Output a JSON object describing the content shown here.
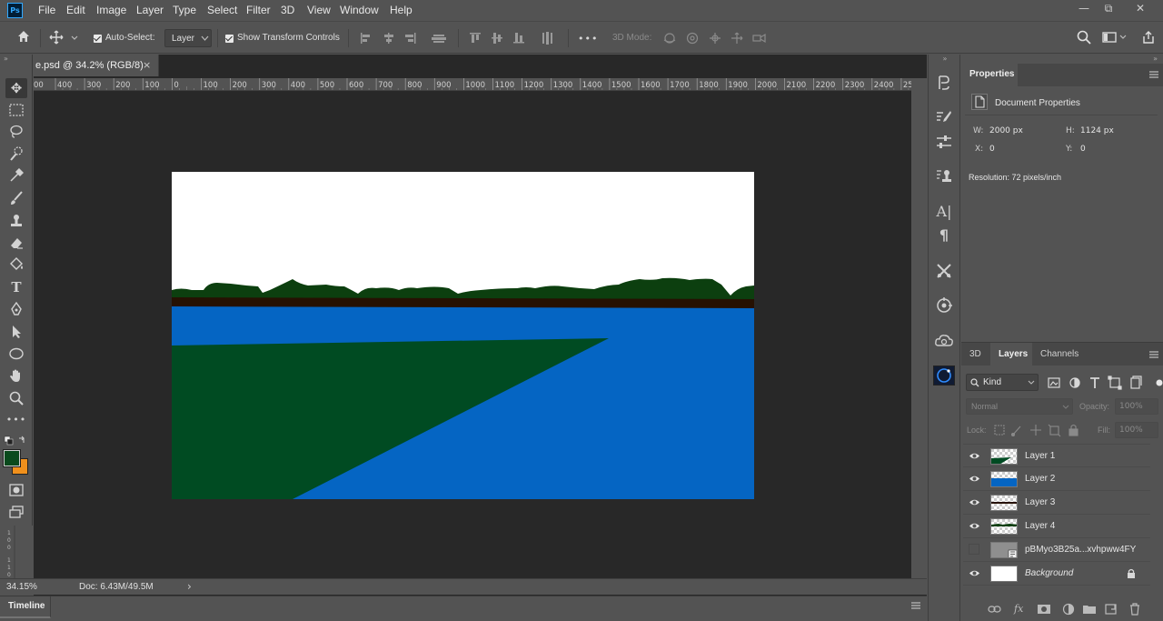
{
  "app": {
    "logo": "Ps"
  },
  "menu": [
    "File",
    "Edit",
    "Image",
    "Layer",
    "Type",
    "Select",
    "Filter",
    "3D",
    "View",
    "Window",
    "Help"
  ],
  "window_controls": {
    "minimize": "—",
    "restore": "⧉",
    "close": "✕"
  },
  "options": {
    "auto_select_label": "Auto-Select:",
    "auto_select_value": "Layer",
    "show_transform_label": "Show Transform Controls",
    "more_label": "•••",
    "mode_3d_label": "3D Mode:"
  },
  "document": {
    "tab_title": "e.psd @ 34.2% (RGB/8)",
    "tab_close": "×",
    "ruler_labels": [
      "400",
      "300",
      "200",
      "100",
      "0",
      "100",
      "200",
      "300",
      "400",
      "500",
      "600",
      "700",
      "800",
      "900",
      "1000",
      "1100",
      "1200",
      "1300",
      "1400",
      "1500",
      "1600",
      "1700",
      "1800",
      "1900",
      "2000",
      "2100",
      "2200",
      "2300",
      "2400",
      "25"
    ],
    "ruler_first": "00"
  },
  "status": {
    "zoom": "34.15%",
    "doc": "Doc: 6.43M/49.5M",
    "arrow": "›"
  },
  "timeline": {
    "label": "Timeline"
  },
  "properties": {
    "tab": "Properties",
    "section": "Document Properties",
    "w_label": "W:",
    "w_value": "2000 px",
    "h_label": "H:",
    "h_value": "1124 px",
    "x_label": "X:",
    "x_value": "0",
    "y_label": "Y:",
    "y_value": "0",
    "resolution": "Resolution: 72 pixels/inch"
  },
  "layers_panel": {
    "tabs": [
      "3D",
      "Layers",
      "Channels"
    ],
    "active_tab": "Layers",
    "filter_kind": "Kind",
    "blend_mode": "Normal",
    "opacity_label": "Opacity:",
    "opacity_value": "100%",
    "lock_label": "Lock:",
    "fill_label": "Fill:",
    "fill_value": "100%",
    "layers": [
      {
        "name": "Layer 1",
        "visible": true
      },
      {
        "name": "Layer 2",
        "visible": true
      },
      {
        "name": "Layer 3",
        "visible": true
      },
      {
        "name": "Layer 4",
        "visible": true
      },
      {
        "name": "pBMyo3B25a...xvhpww4FY",
        "visible": false
      },
      {
        "name": "Background",
        "visible": true,
        "locked": true
      }
    ],
    "footer_icons": [
      "link-icon",
      "fx-icon",
      "mask-icon",
      "adjustment-icon",
      "group-icon",
      "new-layer-icon",
      "trash-icon"
    ]
  },
  "colors": {
    "foreground": "#0a4a1d",
    "background": "#f0901c",
    "sky": "#ffffff",
    "treeline": "#0c3f0f",
    "water": "#0565c3",
    "grass": "#004b22",
    "shore": "#261102"
  }
}
